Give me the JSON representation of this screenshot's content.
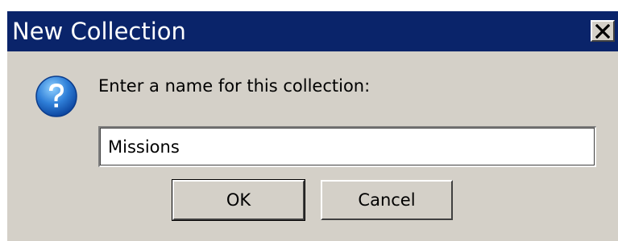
{
  "dialog": {
    "title": "New Collection",
    "close_icon": "close-icon",
    "prompt_icon": "question-icon",
    "prompt": "Enter a name for this collection:",
    "input_value": "Missions",
    "ok_label": "OK",
    "cancel_label": "Cancel"
  },
  "colors": {
    "titlebar": "#0a246a",
    "dialog_bg": "#d4d0c8",
    "icon_blue": "#1565c0"
  }
}
